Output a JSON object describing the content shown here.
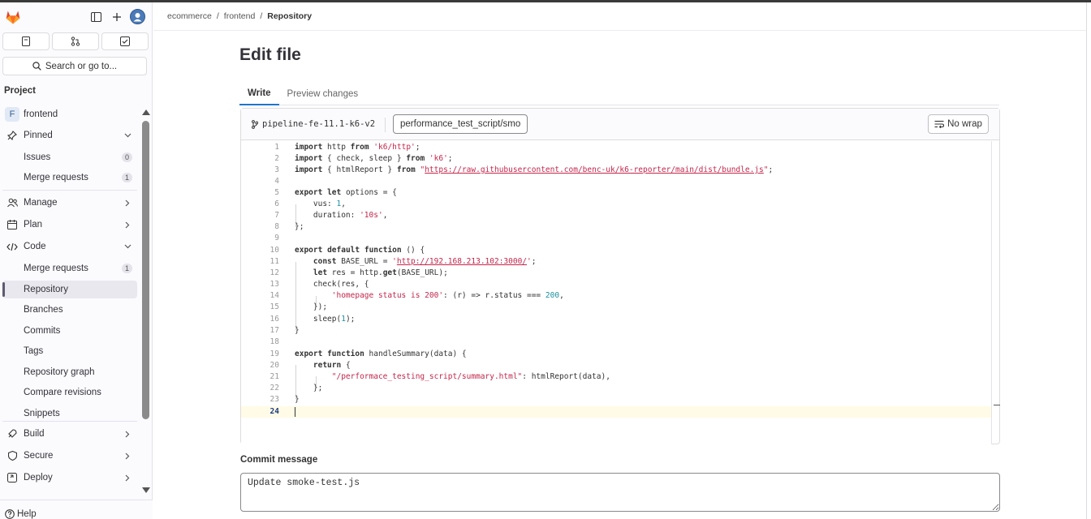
{
  "sidebar": {
    "search_label": "Search or go to...",
    "project_heading": "Project",
    "project_initial": "F",
    "project_name": "frontend",
    "pinned_label": "Pinned",
    "pinned_items": [
      {
        "label": "Issues",
        "count": "0"
      },
      {
        "label": "Merge requests",
        "count": "1"
      }
    ],
    "manage_label": "Manage",
    "plan_label": "Plan",
    "code_label": "Code",
    "code_items": [
      {
        "label": "Merge requests",
        "count": "1"
      },
      {
        "label": "Repository"
      },
      {
        "label": "Branches"
      },
      {
        "label": "Commits"
      },
      {
        "label": "Tags"
      },
      {
        "label": "Repository graph"
      },
      {
        "label": "Compare revisions"
      },
      {
        "label": "Snippets"
      }
    ],
    "build_label": "Build",
    "secure_label": "Secure",
    "deploy_label": "Deploy",
    "help_label": "Help"
  },
  "breadcrumb": {
    "group": "ecommerce",
    "project": "frontend",
    "current": "Repository"
  },
  "page": {
    "title": "Edit file",
    "tab_write": "Write",
    "tab_preview": "Preview changes"
  },
  "editor": {
    "branch": "pipeline-fe-11.1-k6-v2",
    "filename": "performance_test_script/smoke-test.js",
    "wrap_label": "No wrap",
    "current_line": 24
  },
  "commit": {
    "label": "Commit message",
    "value": "Update smoke-test.js"
  },
  "colors": {
    "accent": "#1f75cb",
    "string": "#c3264a",
    "number": "#1a8fa0"
  }
}
